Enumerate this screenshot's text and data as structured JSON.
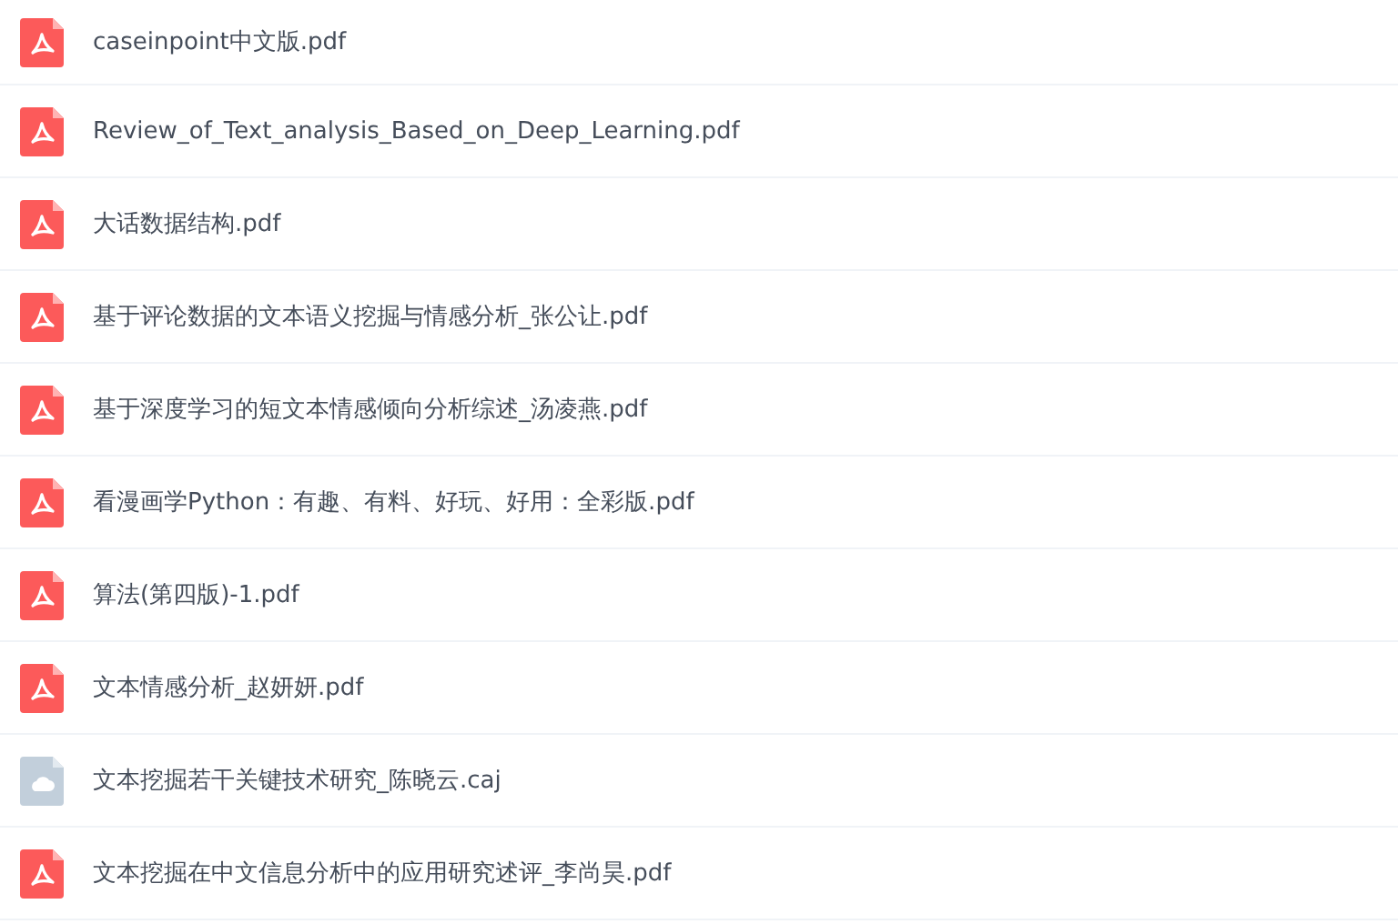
{
  "files": [
    {
      "name": "caseinpoint中文版.pdf",
      "kind": "pdf"
    },
    {
      "name": "Review_of_Text_analysis_Based_on_Deep_Learning.pdf",
      "kind": "pdf"
    },
    {
      "name": "大话数据结构.pdf",
      "kind": "pdf"
    },
    {
      "name": "基于评论数据的文本语义挖掘与情感分析_张公让.pdf",
      "kind": "pdf"
    },
    {
      "name": "基于深度学习的短文本情感倾向分析综述_汤凌燕.pdf",
      "kind": "pdf"
    },
    {
      "name": "看漫画学Python：有趣、有料、好玩、好用：全彩版.pdf",
      "kind": "pdf"
    },
    {
      "name": "算法(第四版)-1.pdf",
      "kind": "pdf"
    },
    {
      "name": "文本情感分析_赵妍妍.pdf",
      "kind": "pdf"
    },
    {
      "name": "文本挖掘若干关键技术研究_陈晓云.caj",
      "kind": "cloud"
    },
    {
      "name": "文本挖掘在中文信息分析中的应用研究述评_李尚昊.pdf",
      "kind": "pdf"
    }
  ]
}
